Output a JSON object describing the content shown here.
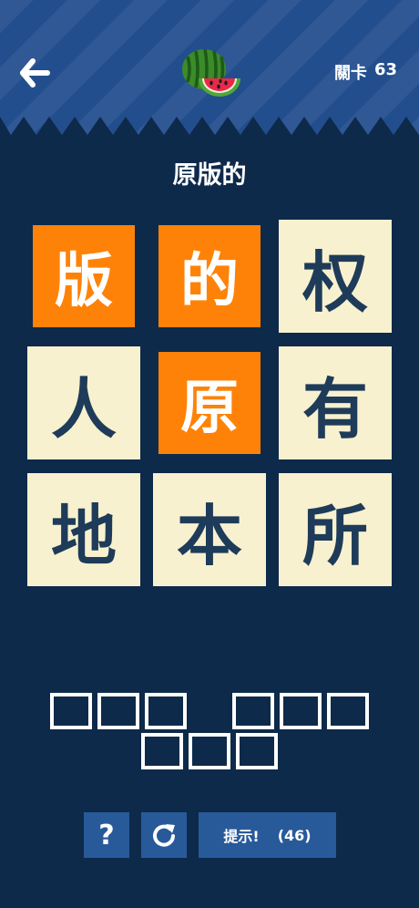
{
  "header": {
    "level_label": "關卡",
    "level_number": "63",
    "logo_icon": "watermelon-icon",
    "back_icon": "arrow-left-icon"
  },
  "clue": "原版的",
  "grid": {
    "tiles": [
      {
        "char": "版",
        "selected": true
      },
      {
        "char": "的",
        "selected": true
      },
      {
        "char": "权",
        "selected": false
      },
      {
        "char": "人",
        "selected": false
      },
      {
        "char": "原",
        "selected": true
      },
      {
        "char": "有",
        "selected": false
      },
      {
        "char": "地",
        "selected": false
      },
      {
        "char": "本",
        "selected": false
      },
      {
        "char": "所",
        "selected": false
      }
    ]
  },
  "answer": {
    "words": [
      [
        3,
        3
      ],
      [
        3
      ]
    ]
  },
  "buttons": {
    "help_label": "?",
    "reset_icon": "refresh-icon",
    "hint_label": "提示!",
    "hint_count": "(46)"
  },
  "colors": {
    "background": "#0e2a4a",
    "header": "#224e8e",
    "tile": "#f8f1cf",
    "tile_text": "#1e3c59",
    "tile_selected": "#ff8208",
    "button": "#285a9a"
  }
}
